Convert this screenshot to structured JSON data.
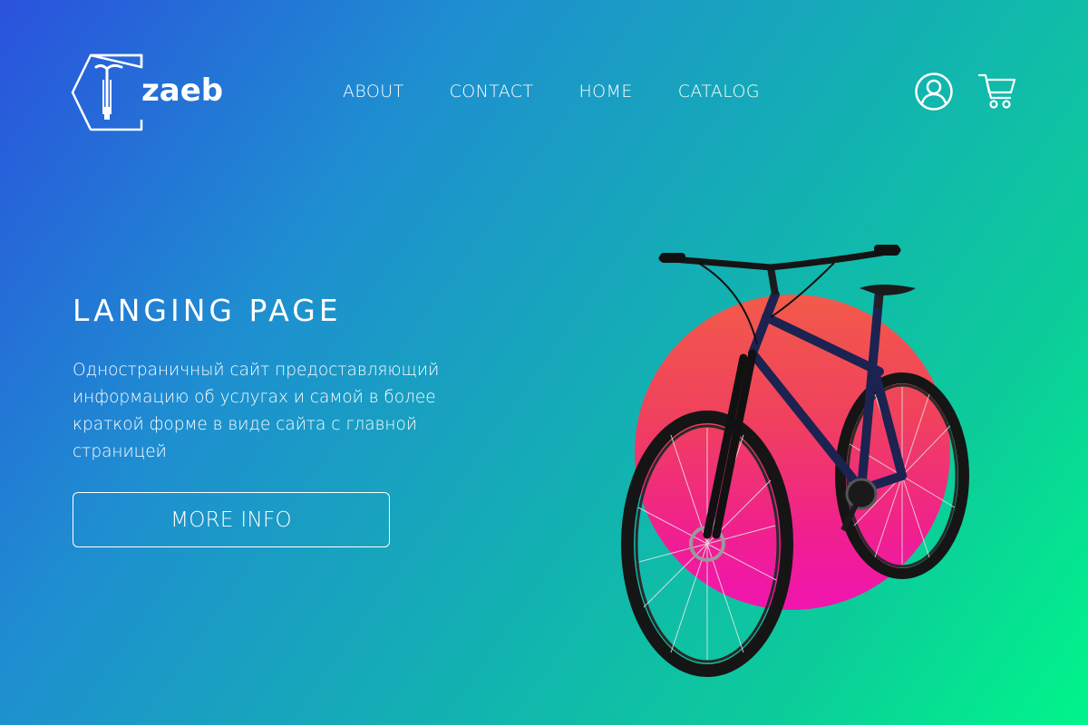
{
  "header": {
    "logo_text": "zaeb",
    "nav": [
      "ABOUT",
      "CONTACT",
      "HOME",
      "CATALOG"
    ]
  },
  "hero": {
    "title": "LANGING PAGE",
    "description": "Одностраничный сайт предоставляющий информацию об услугах и самой в более краткой форме в виде сайта с главной страницей",
    "button_label": "MORE INFO"
  },
  "colors": {
    "gradient_start": "#2a52dd",
    "gradient_end": "#00f58a",
    "circle_top": "#f25a4a",
    "circle_bottom": "#f015b0",
    "text": "#ffffff"
  },
  "icons": [
    "bike-logo-icon",
    "user-icon",
    "cart-icon"
  ]
}
